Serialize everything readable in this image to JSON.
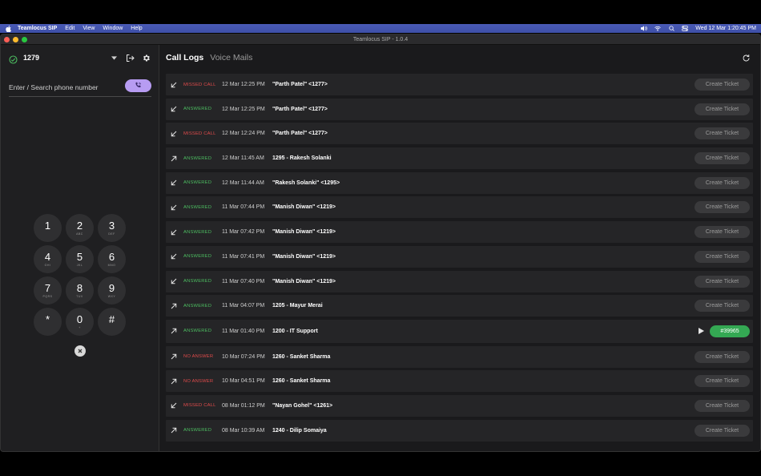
{
  "menubar": {
    "app_name": "Teamlocus SIP",
    "items": [
      "Edit",
      "View",
      "Window",
      "Help"
    ],
    "clock": "Wed 12 Mar  1:20:45 PM"
  },
  "window": {
    "title": "Teamlocus SIP - 1.0.4"
  },
  "sidebar": {
    "extension": "1279",
    "phone_placeholder": "Enter / Search phone number",
    "keys": [
      {
        "digit": "1",
        "letters": ""
      },
      {
        "digit": "2",
        "letters": "ABC"
      },
      {
        "digit": "3",
        "letters": "DEF"
      },
      {
        "digit": "4",
        "letters": "GHI"
      },
      {
        "digit": "5",
        "letters": "JKL"
      },
      {
        "digit": "6",
        "letters": "MNO"
      },
      {
        "digit": "7",
        "letters": "PQRS"
      },
      {
        "digit": "8",
        "letters": "TUV"
      },
      {
        "digit": "9",
        "letters": "WXY"
      },
      {
        "digit": "*",
        "letters": ""
      },
      {
        "digit": "0",
        "letters": "+"
      },
      {
        "digit": "#",
        "letters": ""
      }
    ]
  },
  "main": {
    "tabs": [
      {
        "label": "Call Logs",
        "active": true
      },
      {
        "label": "Voice Mails",
        "active": false
      }
    ],
    "create_ticket_label": "Create Ticket",
    "logs": [
      {
        "direction": "incoming",
        "status": "MISSED CALL",
        "time": "12 Mar 12:25 PM",
        "caller": "\"Parth Patel\" <1277>"
      },
      {
        "direction": "incoming",
        "status": "ANSWERED",
        "time": "12 Mar 12:25 PM",
        "caller": "\"Parth Patel\" <1277>"
      },
      {
        "direction": "incoming",
        "status": "MISSED CALL",
        "time": "12 Mar 12:24 PM",
        "caller": "\"Parth Patel\" <1277>"
      },
      {
        "direction": "outgoing",
        "status": "ANSWERED",
        "time": "12 Mar 11:45 AM",
        "caller": "1295 - Rakesh Solanki"
      },
      {
        "direction": "incoming",
        "status": "ANSWERED",
        "time": "12 Mar 11:44 AM",
        "caller": "\"Rakesh Solanki\" <1295>"
      },
      {
        "direction": "incoming",
        "status": "ANSWERED",
        "time": "11 Mar 07:44 PM",
        "caller": "\"Manish Diwan\" <1219>"
      },
      {
        "direction": "incoming",
        "status": "ANSWERED",
        "time": "11 Mar 07:42 PM",
        "caller": "\"Manish Diwan\" <1219>"
      },
      {
        "direction": "incoming",
        "status": "ANSWERED",
        "time": "11 Mar 07:41 PM",
        "caller": "\"Manish Diwan\" <1219>"
      },
      {
        "direction": "incoming",
        "status": "ANSWERED",
        "time": "11 Mar 07:40 PM",
        "caller": "\"Manish Diwan\" <1219>"
      },
      {
        "direction": "outgoing",
        "status": "ANSWERED",
        "time": "11 Mar 04:07 PM",
        "caller": "1205 - Mayur Merai"
      },
      {
        "direction": "outgoing",
        "status": "ANSWERED",
        "time": "11 Mar 01:40 PM",
        "caller": "1200 - IT Support",
        "ticket": "#39965",
        "recording": true
      },
      {
        "direction": "outgoing",
        "status": "NO ANSWER",
        "time": "10 Mar 07:24 PM",
        "caller": "1260 - Sanket Sharma"
      },
      {
        "direction": "outgoing",
        "status": "NO ANSWER",
        "time": "10 Mar 04:51 PM",
        "caller": "1260 - Sanket Sharma"
      },
      {
        "direction": "incoming",
        "status": "MISSED CALL",
        "time": "08 Mar 01:12 PM",
        "caller": "\"Nayan Gohel\" <1261>"
      },
      {
        "direction": "outgoing",
        "status": "ANSWERED",
        "time": "08 Mar 10:39 AM",
        "caller": "1240 - Dilip Somaiya"
      }
    ]
  },
  "colors": {
    "accent": "#b79cf2",
    "missed": "#e04b4b",
    "answered": "#4cbb60",
    "ticket_badge": "#34a853"
  }
}
